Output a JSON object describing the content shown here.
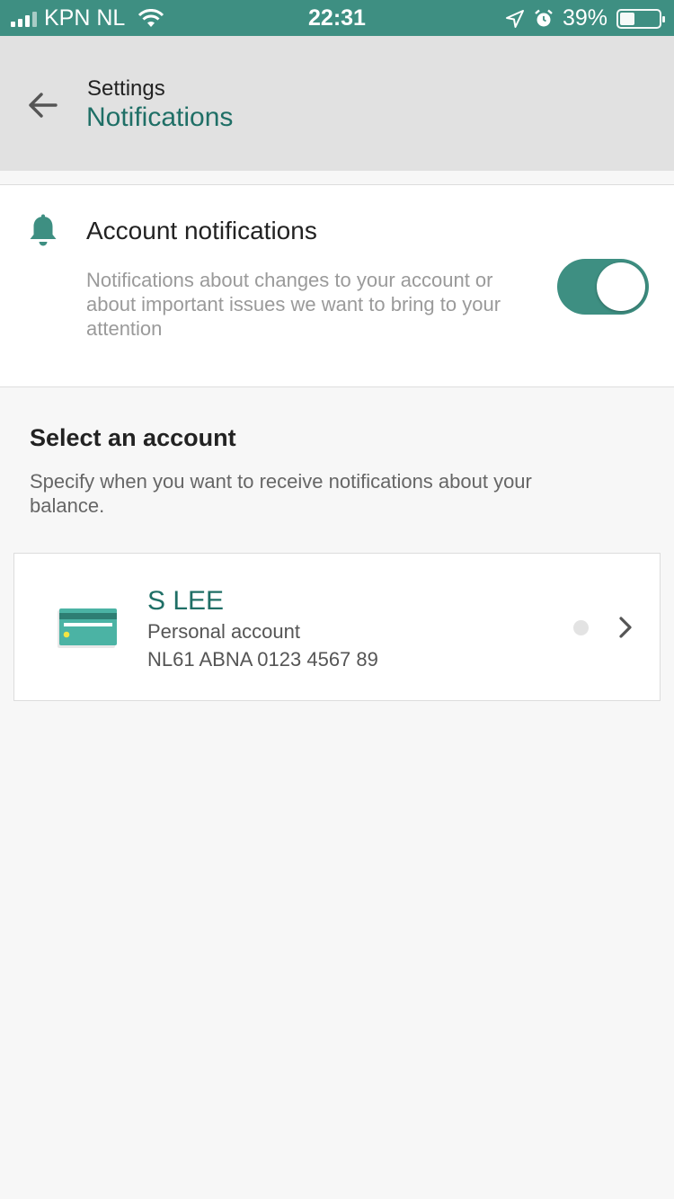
{
  "status_bar": {
    "carrier": "KPN NL",
    "time": "22:31",
    "battery": "39%",
    "battery_level": 0.39
  },
  "header": {
    "breadcrumb": "Settings",
    "title": "Notifications"
  },
  "account_notifications": {
    "title": "Account notifications",
    "description": "Notifications about changes to your account or about important issues we want to bring to your attention",
    "enabled": true
  },
  "select_account": {
    "title": "Select an account",
    "description": "Specify when you want to receive notifications about your balance."
  },
  "accounts": [
    {
      "name": "S LEE",
      "type": "Personal account",
      "iban": "NL61 ABNA 0123 4567 89"
    }
  ],
  "colors": {
    "accent": "#3e8f82",
    "title_teal": "#1f6f66",
    "header_bg": "#e1e1e1"
  }
}
